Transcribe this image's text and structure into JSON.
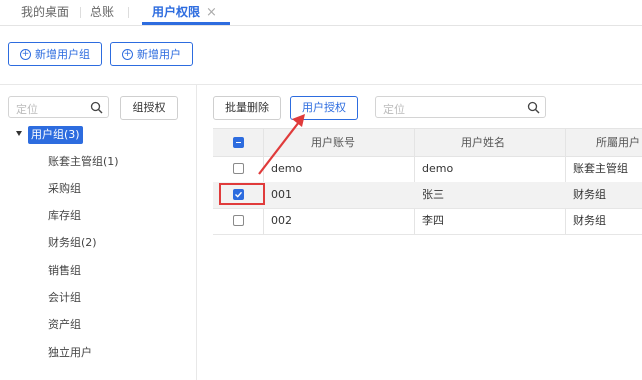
{
  "tabs": [
    {
      "label": "我的桌面",
      "active": false
    },
    {
      "label": "总账",
      "active": false
    },
    {
      "label": "用户权限",
      "active": true,
      "close": "×"
    }
  ],
  "toolbar": {
    "add_group": "新增用户组",
    "add_user": "新增用户"
  },
  "left": {
    "search_placeholder": "定位",
    "group_auth": "组授权",
    "tree_root": "用户组(3)",
    "tree_items": [
      "账套主管组(1)",
      "采购组",
      "库存组",
      "财务组(2)",
      "销售组",
      "会计组",
      "资产组",
      "独立用户"
    ]
  },
  "right": {
    "batch_delete": "批量删除",
    "user_auth": "用户授权",
    "search_placeholder": "定位",
    "columns": [
      "用户账号",
      "用户姓名",
      "所屬用户"
    ],
    "rows": [
      {
        "account": "demo",
        "name": "demo",
        "group": "账套主管组",
        "checked": false
      },
      {
        "account": "001",
        "name": "张三",
        "group": "财务组",
        "checked": true
      },
      {
        "account": "002",
        "name": "李四",
        "group": "财务组",
        "checked": false
      }
    ]
  },
  "colors": {
    "accent": "#2d6cdf",
    "highlight": "#e03b3b"
  }
}
